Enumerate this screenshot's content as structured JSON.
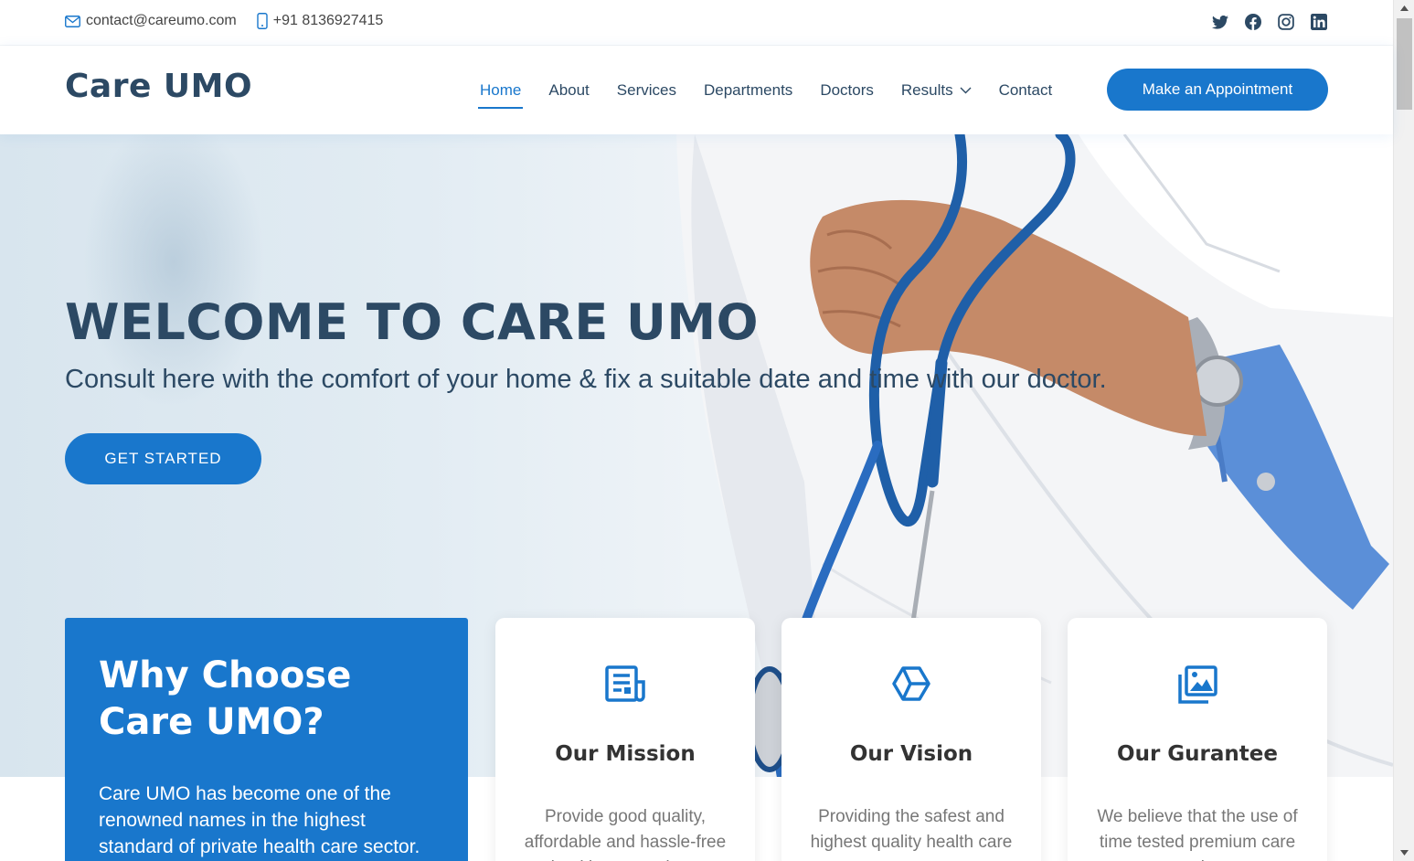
{
  "topbar": {
    "email": "contact@careumo.com",
    "phone": "+91 8136927415",
    "social_icons": [
      "twitter-icon",
      "facebook-icon",
      "instagram-icon",
      "linkedin-icon"
    ]
  },
  "header": {
    "logo": "Care UMO",
    "nav": [
      {
        "label": "Home",
        "active": true
      },
      {
        "label": "About"
      },
      {
        "label": "Services"
      },
      {
        "label": "Departments"
      },
      {
        "label": "Doctors"
      },
      {
        "label": "Results",
        "dropdown": true
      },
      {
        "label": "Contact"
      }
    ],
    "cta": "Make an Appointment"
  },
  "hero": {
    "title": "WELCOME TO CARE UMO",
    "subtitle": "Consult here with the comfort of your home & fix a suitable date and time with our doctor.",
    "button": "GET STARTED"
  },
  "why": {
    "title": "Why Choose Care UMO?",
    "text": "Care UMO has become one of the renowned names in the highest standard of private health care sector."
  },
  "cards": [
    {
      "icon": "document-icon",
      "title": "Our Mission",
      "text": "Provide good quality, affordable and hassle-free health care to the..."
    },
    {
      "icon": "cube-icon",
      "title": "Our Vision",
      "text": "Providing the safest and highest quality health care to..."
    },
    {
      "icon": "images-icon",
      "title": "Our Gurantee",
      "text": "We believe that the use of time tested premium care and..."
    }
  ],
  "colors": {
    "accent": "#1977cc",
    "heading": "#2c4964"
  }
}
